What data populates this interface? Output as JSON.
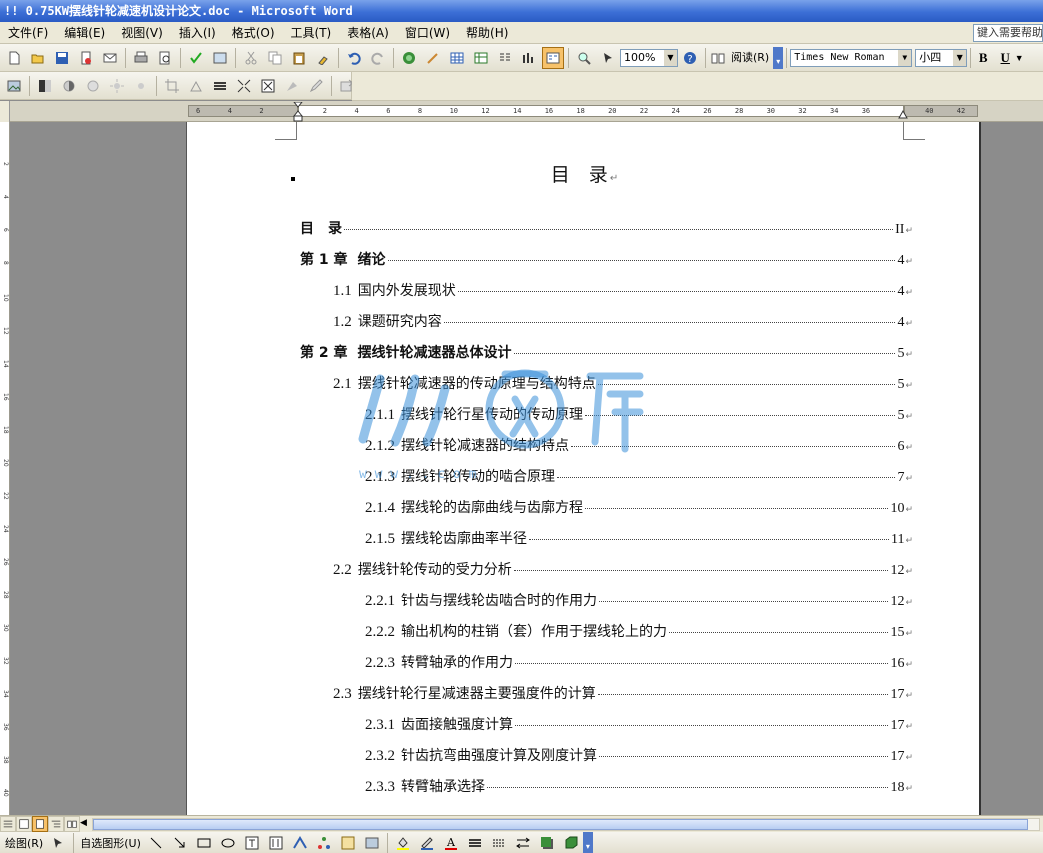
{
  "window": {
    "title": "!! 0.75KW摆线针轮减速机设计论文.doc - Microsoft Word"
  },
  "menu": {
    "items": [
      "文件(F)",
      "编辑(E)",
      "视图(V)",
      "插入(I)",
      "格式(O)",
      "工具(T)",
      "表格(A)",
      "窗口(W)",
      "帮助(H)"
    ],
    "help_placeholder": "键入需要帮助"
  },
  "toolbar": {
    "zoom": "100%",
    "read_label": "阅读(R)",
    "font_name": "Times New Roman",
    "font_size": "小四",
    "bold": "B",
    "underline": "U"
  },
  "ruler": {
    "ticks": [
      "6",
      "4",
      "2",
      "",
      "2",
      "4",
      "6",
      "8",
      "10",
      "12",
      "14",
      "16",
      "18",
      "20",
      "22",
      "24",
      "26",
      "28",
      "30",
      "32",
      "34",
      "36",
      "",
      "40",
      "42"
    ],
    "vticks": [
      "2",
      "4",
      "6",
      "8",
      "10",
      "12",
      "14",
      "16",
      "18",
      "20",
      "22",
      "24",
      "26",
      "28",
      "30",
      "32",
      "34",
      "36",
      "38",
      "40"
    ]
  },
  "document": {
    "toc_title": "目　录",
    "entries": [
      {
        "num": "",
        "text": "目　录",
        "bold": true,
        "page": "II",
        "level": 0
      },
      {
        "num": "第 1 章",
        "text": "绪论",
        "bold": true,
        "page": "4",
        "level": 0
      },
      {
        "num": "1.1",
        "text": "国内外发展现状",
        "bold": false,
        "page": "4",
        "level": 1
      },
      {
        "num": "1.2",
        "text": "课题研究内容",
        "bold": false,
        "page": "4",
        "level": 1
      },
      {
        "num": "第 2 章",
        "text": "摆线针轮减速器总体设计",
        "bold": true,
        "page": "5",
        "level": 0
      },
      {
        "num": "2.1",
        "text": "摆线针轮减速器的传动原理与结构特点",
        "bold": false,
        "page": "5",
        "level": 1
      },
      {
        "num": "2.1.1",
        "text": "摆线针轮行星传动的传动原理",
        "bold": false,
        "page": "5",
        "level": 2
      },
      {
        "num": "2.1.2",
        "text": "摆线针轮减速器的结构特点",
        "bold": false,
        "page": "6",
        "level": 2
      },
      {
        "num": "2.1.3",
        "text": "摆线针轮传动的啮合原理",
        "bold": false,
        "page": "7",
        "level": 2
      },
      {
        "num": "2.1.4",
        "text": "摆线轮的齿廓曲线与齿廓方程",
        "bold": false,
        "page": "10",
        "level": 2
      },
      {
        "num": "2.1.5",
        "text": "摆线轮齿廓曲率半径",
        "bold": false,
        "page": "11",
        "level": 2
      },
      {
        "num": "2.2",
        "text": "摆线针轮传动的受力分析",
        "bold": false,
        "page": "12",
        "level": 1
      },
      {
        "num": "2.2.1",
        "text": "针齿与摆线轮齿啮合时的作用力",
        "bold": false,
        "page": "12",
        "level": 2
      },
      {
        "num": "2.2.2",
        "text": "输出机构的柱销（套）作用于摆线轮上的力",
        "bold": false,
        "page": "15",
        "level": 2
      },
      {
        "num": "2.2.3",
        "text": "转臂轴承的作用力",
        "bold": false,
        "page": "16",
        "level": 2
      },
      {
        "num": "2.3",
        "text": "摆线针轮行星减速器主要强度件的计算",
        "bold": false,
        "page": "17",
        "level": 1
      },
      {
        "num": "2.3.1",
        "text": "齿面接触强度计算",
        "bold": false,
        "page": "17",
        "level": 2
      },
      {
        "num": "2.3.2",
        "text": "针齿抗弯曲强度计算及刚度计算",
        "bold": false,
        "page": "17",
        "level": 2
      },
      {
        "num": "2.3.3",
        "text": "转臂轴承选择",
        "bold": false,
        "page": "18",
        "level": 2
      }
    ]
  },
  "watermark": {
    "url_text": "w w w . . c o m"
  },
  "drawbar": {
    "draw_label": "绘图(R)",
    "autoshape_label": "自选图形(U)"
  },
  "colors": {
    "titlebar": "#3c6fd6",
    "menubar": "#ece9d8",
    "workspace": "#8c8c8c",
    "watermark": "#3a8fd8"
  }
}
